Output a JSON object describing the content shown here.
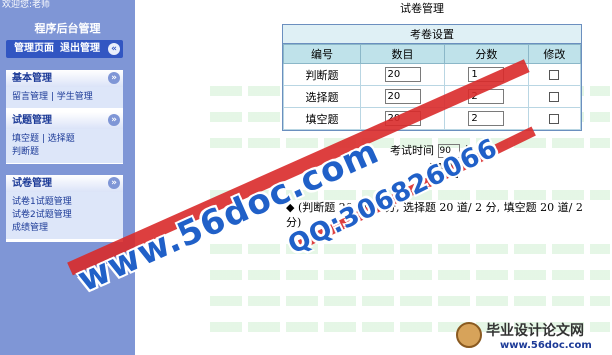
{
  "sidebar": {
    "user_text": "欢迎您:老师",
    "app_title": "程序后台管理",
    "top_links": [
      "管理页面",
      "退出管理"
    ],
    "collapse_glyph": "«",
    "expand_glyph": "»",
    "panels": [
      {
        "title": "基本管理",
        "links": [
          "留言管理",
          "学生管理"
        ]
      },
      {
        "title": "试题管理",
        "links": [
          "填空题",
          "选择题",
          "判断题"
        ]
      },
      {
        "title": "试卷管理",
        "links": [
          "试卷1试题管理",
          "试卷2试题管理",
          "成绩管理"
        ]
      }
    ]
  },
  "main": {
    "page_title": "试卷管理",
    "settings_title": "考卷设置",
    "columns": [
      "编号",
      "数目",
      "分数",
      "修改"
    ],
    "rows": [
      {
        "name": "判断题",
        "count": "20",
        "score": "1"
      },
      {
        "name": "选择题",
        "count": "20",
        "score": "2"
      },
      {
        "name": "填空题",
        "count": "20",
        "score": "2"
      }
    ],
    "time_label": "考试时间",
    "time_value": "90",
    "time_unit": "分",
    "submit_label": "设置",
    "summary_bullet": "◆",
    "summary_text": "(判断题 20 道/ 1 分, 选择题 20 道/ 2 分, 填空题 20 道/ 2 分)"
  },
  "watermark": {
    "site": "www.56doc.com",
    "qq": "QQ:306826066"
  },
  "logo": {
    "title": "毕业设计论文网",
    "url": "www.56doc.com"
  },
  "colors": {
    "sidebar_bg": "#7f96d6",
    "header_bar": "#3256c2",
    "table_header": "#bfe2ea",
    "watermark_blue": "#2060c8",
    "watermark_red": "#d92a2a"
  }
}
